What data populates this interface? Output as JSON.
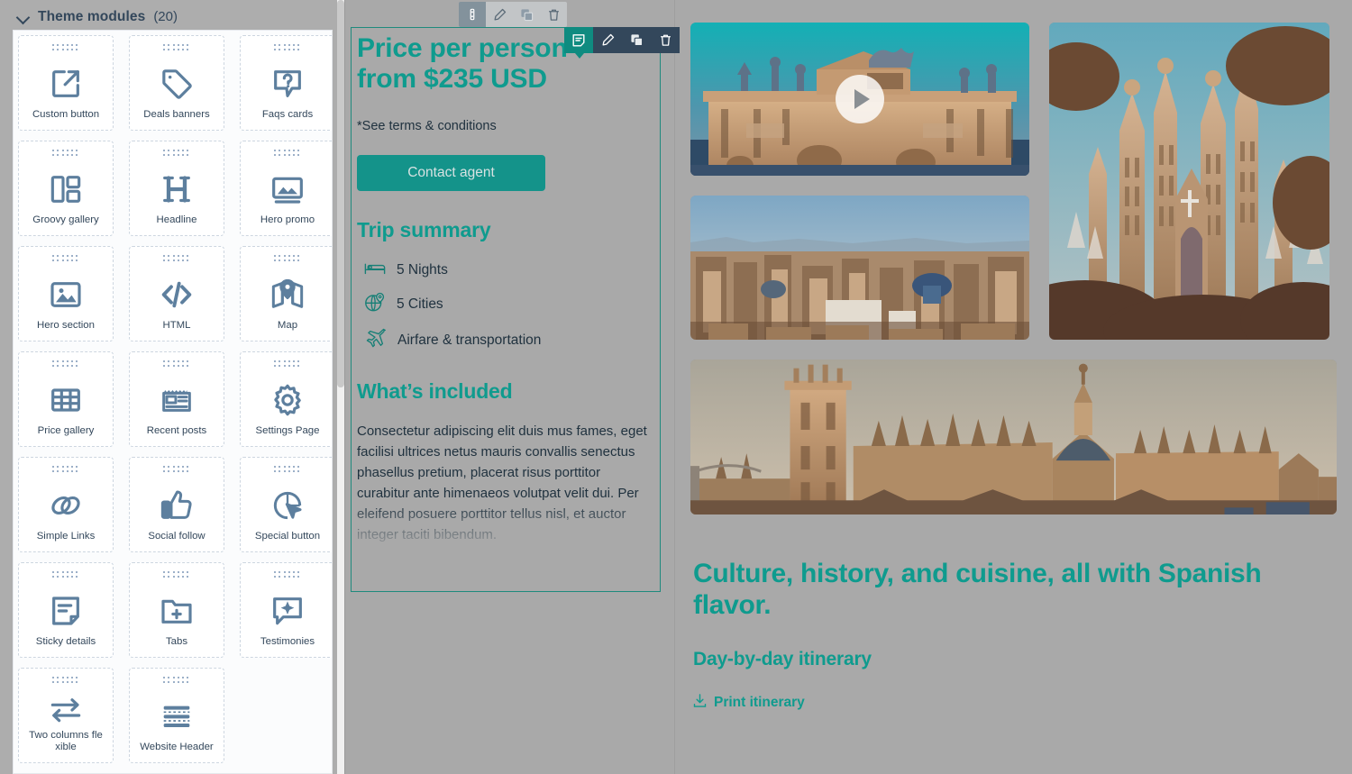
{
  "sidebar": {
    "title": "Theme modules",
    "count": "(20)",
    "modules": [
      {
        "label": "Custom button",
        "icon": "external-link-icon"
      },
      {
        "label": "Deals banners",
        "icon": "tag-icon"
      },
      {
        "label": "Faqs cards",
        "icon": "question-bubble-icon"
      },
      {
        "label": "Groovy gallery",
        "icon": "layout-columns-icon"
      },
      {
        "label": "Headline",
        "icon": "heading-h-icon"
      },
      {
        "label": "Hero promo",
        "icon": "image-frame-icon"
      },
      {
        "label": "Hero section",
        "icon": "picture-icon"
      },
      {
        "label": "HTML",
        "icon": "code-brackets-icon"
      },
      {
        "label": "Map",
        "icon": "map-pin-icon"
      },
      {
        "label": "Price gallery",
        "icon": "grid-table-icon"
      },
      {
        "label": "Recent posts",
        "icon": "news-posts-icon"
      },
      {
        "label": "Settings Page",
        "icon": "gear-icon"
      },
      {
        "label": "Simple Links",
        "icon": "chain-link-icon"
      },
      {
        "label": "Social follow",
        "icon": "thumbs-up-icon"
      },
      {
        "label": "Special button",
        "icon": "cursor-click-icon"
      },
      {
        "label": "Sticky details",
        "icon": "note-document-icon"
      },
      {
        "label": "Tabs",
        "icon": "folder-plus-icon"
      },
      {
        "label": "Testimonies",
        "icon": "sparkle-bubble-icon"
      },
      {
        "label": "Two columns fle xible",
        "icon": "two-arrows-icon"
      },
      {
        "label": "Website Header",
        "icon": "menu-lines-icon"
      }
    ]
  },
  "editor": {
    "toolbar_outer": {
      "handle": "drag-handle-icon",
      "buttons": [
        "edit-pencil-icon",
        "clone-copy-icon",
        "delete-trash-icon"
      ]
    },
    "toolbar_inner": {
      "handle": "module-note-icon",
      "buttons": [
        "edit-pencil-icon",
        "clone-copy-icon",
        "delete-trash-icon"
      ]
    },
    "headline": "Price per person\nfrom $235 USD",
    "terms": "*See terms & conditions",
    "contact_button": "Contact agent",
    "trip_summary_title": "Trip summary",
    "trip_summary_items": [
      {
        "icon": "bed-icon",
        "text": "5 Nights"
      },
      {
        "icon": "globe-pin-icon",
        "text": "5 Cities"
      },
      {
        "icon": "airplane-icon",
        "text": "Airfare & transportation"
      }
    ],
    "included_title": "What’s included",
    "included_body": "Consectetur adipiscing elit duis mus fames, eget facilisi ultrices netus mauris convallis senectus phasellus pretium, placerat risus porttitor curabitur ante himenaeos volutpat velit dui. Per eleifend posuere porttitor tellus nisl, et auctor integer taciti bibendum."
  },
  "preview": {
    "photos": [
      {
        "name": "madrid-puerta-de-alcala-video",
        "overlay": "play-button-icon"
      },
      {
        "name": "valencia-cityscape",
        "overlay": ""
      },
      {
        "name": "barcelona-sagrada-familia",
        "overlay": ""
      },
      {
        "name": "seville-cathedral-panorama",
        "overlay": ""
      }
    ],
    "heading": "Culture, history, and cuisine, all with Spanish flavor.",
    "subheading": "Day-by-day itinerary",
    "print_link": "Print itinerary",
    "print_icon": "download-icon"
  },
  "colors": {
    "brand_teal": "#0f9b8e",
    "button_teal": "#14938a",
    "selection_outline": "#1f8a7d",
    "sidebar_text": "#33475b",
    "module_icon": "#5d7f9e",
    "canvas_bg": "#a9a9a9",
    "toolbar_dark": "#33475b"
  }
}
